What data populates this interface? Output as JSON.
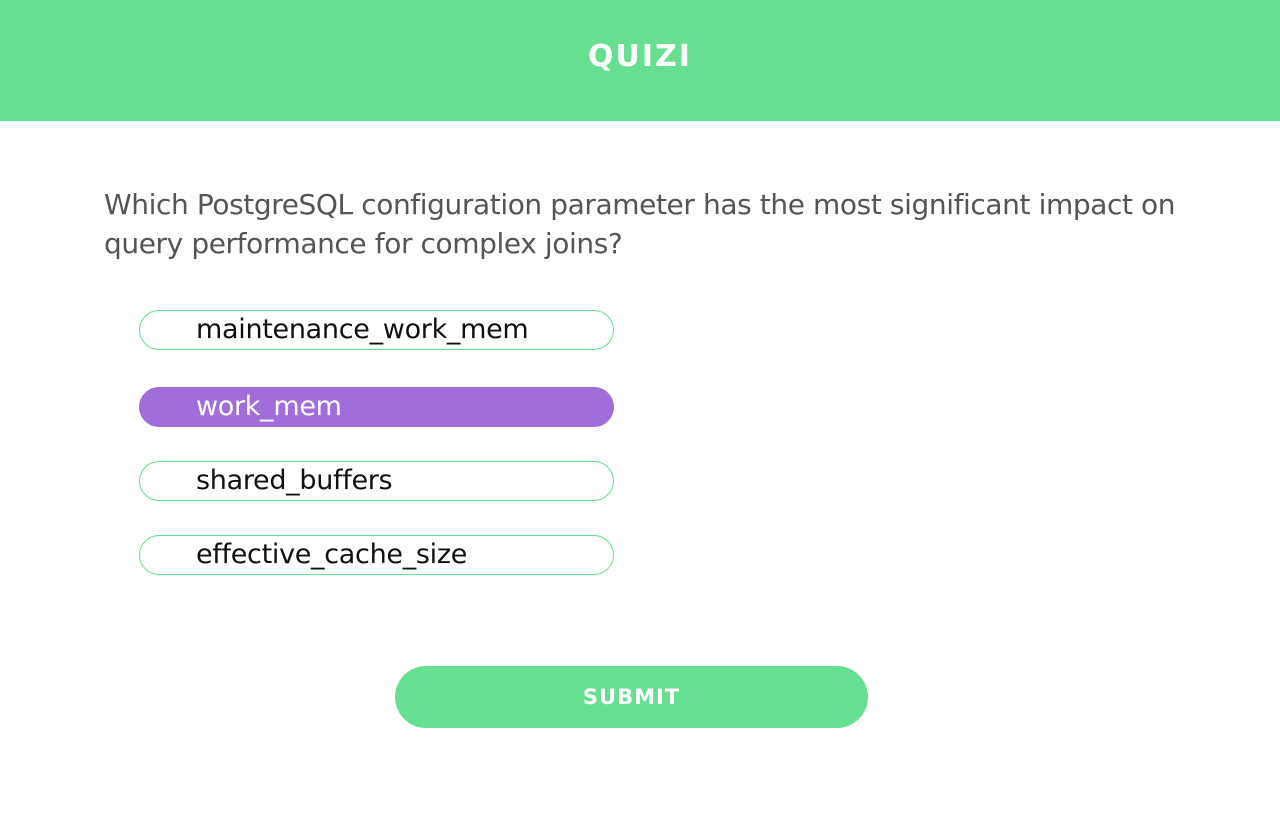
{
  "header": {
    "logo": "QUIZI",
    "background": "#66df90"
  },
  "question": {
    "text": "Which PostgreSQL configuration parameter has the most significant impact on query performance for complex joins?"
  },
  "options": [
    {
      "label": "maintenance_work_mem",
      "selected": false
    },
    {
      "label": "work_mem",
      "selected": true
    },
    {
      "label": "shared_buffers",
      "selected": false
    },
    {
      "label": "effective_cache_size",
      "selected": false
    }
  ],
  "submit": {
    "label": "SUBMIT"
  },
  "colors": {
    "accent": "#66df90",
    "selected": "#a06ddb",
    "question_text": "#555555"
  }
}
